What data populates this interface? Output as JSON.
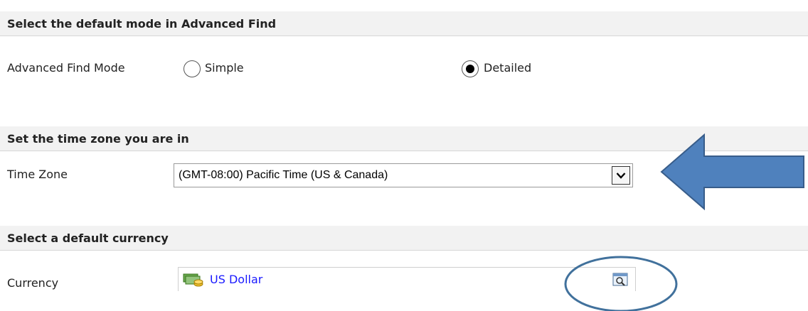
{
  "sections": {
    "advanced_find": {
      "title": "Select the default mode in Advanced Find",
      "field_label": "Advanced Find Mode",
      "options": [
        {
          "label": "Simple",
          "selected": false
        },
        {
          "label": "Detailed",
          "selected": true
        }
      ]
    },
    "time_zone": {
      "title": "Set the time zone you are in",
      "field_label": "Time Zone",
      "selected_value": "(GMT-08:00) Pacific Time (US & Canada)"
    },
    "currency": {
      "title": "Select a default currency",
      "field_label": "Currency",
      "value": "US Dollar"
    }
  },
  "icons": {
    "dropdown": "chevron-down-icon",
    "currency": "currency-icon",
    "lookup": "lookup-search-icon"
  },
  "colors": {
    "link": "#1a1aff",
    "annotation": "#41719c",
    "arrow_fill": "#4f81bd",
    "section_header_bg": "#f2f2f2"
  }
}
